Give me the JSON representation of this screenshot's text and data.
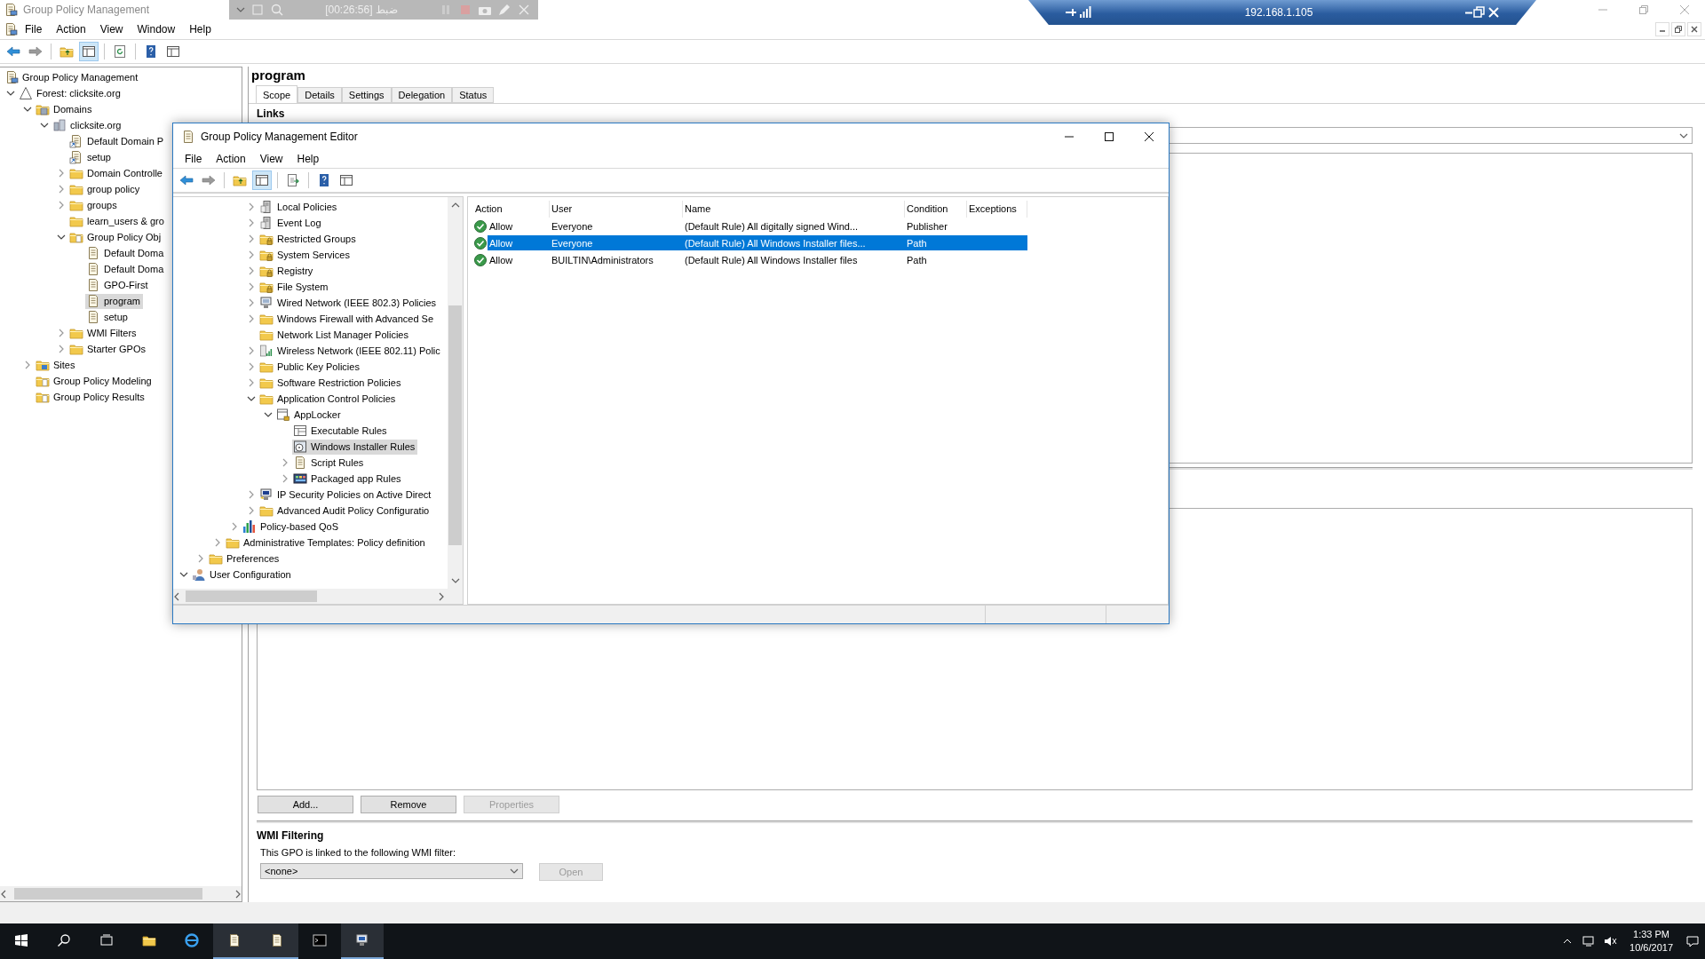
{
  "window": {
    "title": "Group Policy Management"
  },
  "recorder": {
    "label": "ضبط [00:26:56]"
  },
  "remote": {
    "address": "192.168.1.105"
  },
  "menu": [
    "File",
    "Action",
    "View",
    "Window",
    "Help"
  ],
  "tree": [
    {
      "label": "Group Policy Management",
      "kind": "console",
      "selected": false,
      "children": [
        {
          "label": "Forest: clicksite.org",
          "kind": "forest",
          "expanded": true,
          "selected": false,
          "children": [
            {
              "label": "Domains",
              "kind": "domains",
              "expanded": true,
              "selected": false,
              "children": [
                {
                  "label": "clicksite.org",
                  "kind": "domain",
                  "expanded": true,
                  "selected": false,
                  "children": [
                    {
                      "label": "Default Domain P",
                      "kind": "link",
                      "selected": false
                    },
                    {
                      "label": "setup",
                      "kind": "link",
                      "selected": false
                    },
                    {
                      "label": "Domain Controlle",
                      "kind": "ou",
                      "expanded": false,
                      "selected": false
                    },
                    {
                      "label": "group policy",
                      "kind": "ou",
                      "expanded": false,
                      "selected": false
                    },
                    {
                      "label": "groups",
                      "kind": "ou",
                      "expanded": false,
                      "selected": false
                    },
                    {
                      "label": "learn_users & gro",
                      "kind": "ou",
                      "selected": false
                    },
                    {
                      "label": "Group Policy Obj",
                      "kind": "gpo-folder",
                      "expanded": true,
                      "selected": false,
                      "children": [
                        {
                          "label": "Default Doma",
                          "kind": "gpo",
                          "selected": false
                        },
                        {
                          "label": "Default Doma",
                          "kind": "gpo",
                          "selected": false
                        },
                        {
                          "label": "GPO-First",
                          "kind": "gpo",
                          "selected": false
                        },
                        {
                          "label": "program",
                          "kind": "gpo",
                          "selected": true
                        },
                        {
                          "label": "setup",
                          "kind": "gpo",
                          "selected": false
                        }
                      ]
                    },
                    {
                      "label": "WMI Filters",
                      "kind": "wmi",
                      "expanded": false,
                      "selected": false
                    },
                    {
                      "label": "Starter GPOs",
                      "kind": "starter",
                      "expanded": false,
                      "selected": false
                    }
                  ]
                }
              ]
            },
            {
              "label": "Sites",
              "kind": "sites",
              "expanded": false,
              "selected": false
            },
            {
              "label": "Group Policy Modeling",
              "kind": "modeling",
              "selected": false
            },
            {
              "label": "Group Policy Results",
              "kind": "results",
              "selected": false
            }
          ]
        }
      ]
    }
  ],
  "detail": {
    "title": "program",
    "tabs": [
      {
        "label": "Scope",
        "selected": true
      },
      {
        "label": "Details",
        "selected": false
      },
      {
        "label": "Settings",
        "selected": false
      },
      {
        "label": "Delegation",
        "selected": false
      },
      {
        "label": "Status",
        "selected": false
      }
    ],
    "links_label": "Links",
    "buttons": [
      {
        "label": "Add...",
        "disabled": false
      },
      {
        "label": "Remove",
        "disabled": false
      },
      {
        "label": "Properties",
        "disabled": true
      }
    ],
    "wmi": {
      "heading": "WMI Filtering",
      "text": "This GPO is linked to the following WMI filter:",
      "value": "<none>",
      "open": {
        "label": "Open",
        "disabled": true
      }
    }
  },
  "editor": {
    "title": "Group Policy Management Editor",
    "menu": [
      "File",
      "Action",
      "View",
      "Help"
    ],
    "tree": [
      {
        "children": [
          {
            "children": [
              {
                "children": [
                  {
                    "children": [
                      {
                        "label": "Local Policies",
                        "kind": "policy",
                        "expanded": false,
                        "selected": false
                      },
                      {
                        "label": "Event Log",
                        "kind": "policy",
                        "expanded": false,
                        "selected": false
                      },
                      {
                        "label": "Restricted Groups",
                        "kind": "locked",
                        "expanded": false,
                        "selected": false
                      },
                      {
                        "label": "System Services",
                        "kind": "locked",
                        "expanded": false,
                        "selected": false
                      },
                      {
                        "label": "Registry",
                        "kind": "locked",
                        "expanded": false,
                        "selected": false
                      },
                      {
                        "label": "File System",
                        "kind": "locked",
                        "expanded": false,
                        "selected": false
                      },
                      {
                        "label": "Wired Network (IEEE 802.3) Policies",
                        "kind": "network",
                        "expanded": false,
                        "selected": false
                      },
                      {
                        "label": "Windows Firewall with Advanced Se",
                        "kind": "folder",
                        "expanded": false,
                        "selected": false
                      },
                      {
                        "label": "Network List Manager Policies",
                        "kind": "folder",
                        "selected": false
                      },
                      {
                        "label": "Wireless Network (IEEE 802.11) Polic",
                        "kind": "wireless",
                        "expanded": false,
                        "selected": false
                      },
                      {
                        "label": "Public Key Policies",
                        "kind": "folder",
                        "expanded": false,
                        "selected": false
                      },
                      {
                        "label": "Software Restriction Policies",
                        "kind": "folder",
                        "expanded": false,
                        "selected": false
                      },
                      {
                        "label": "Application Control Policies",
                        "kind": "folder",
                        "expanded": true,
                        "selected": false,
                        "children": [
                          {
                            "label": "AppLocker",
                            "kind": "applocker",
                            "expanded": true,
                            "selected": false,
                            "children": [
                              {
                                "label": "Executable Rules",
                                "kind": "rules",
                                "selected": false
                              },
                              {
                                "label": "Windows Installer Rules",
                                "kind": "installer",
                                "selected": true
                              },
                              {
                                "label": "Script Rules",
                                "kind": "script",
                                "expanded": false,
                                "selected": false
                              },
                              {
                                "label": "Packaged app Rules",
                                "kind": "package",
                                "expanded": false,
                                "selected": false
                              }
                            ]
                          }
                        ]
                      },
                      {
                        "label": "IP Security Policies on Active Direct",
                        "kind": "ipsec",
                        "expanded": false,
                        "selected": false
                      },
                      {
                        "label": "Advanced Audit Policy Configuratio",
                        "kind": "folder",
                        "expanded": false,
                        "selected": false
                      }
                    ]
                  },
                  {
                    "label": "Policy-based QoS",
                    "kind": "qos",
                    "expanded": false,
                    "selected": false
                  }
                ]
              },
              {
                "label": "Administrative Templates: Policy definition",
                "kind": "folder",
                "expanded": false,
                "selected": false
              }
            ]
          },
          {
            "label": "Preferences",
            "kind": "folder",
            "expanded": false,
            "selected": false
          }
        ]
      },
      {
        "label": "User Configuration",
        "kind": "user",
        "expanded": true,
        "selected": false
      }
    ],
    "columns": [
      "Action",
      "User",
      "Name",
      "Condition",
      "Exceptions"
    ],
    "rules": [
      {
        "action": "Allow",
        "user": "Everyone",
        "name": "(Default Rule) All digitally signed Wind...",
        "condition": "Publisher",
        "selected": false
      },
      {
        "action": "Allow",
        "user": "Everyone",
        "name": "(Default Rule) All Windows Installer files...",
        "condition": "Path",
        "selected": true
      },
      {
        "action": "Allow",
        "user": "BUILTIN\\Administrators",
        "name": "(Default Rule) All Windows Installer files",
        "condition": "Path",
        "selected": false
      }
    ]
  },
  "taskbar": {
    "time": "1:33 PM",
    "date": "10/6/2017"
  }
}
